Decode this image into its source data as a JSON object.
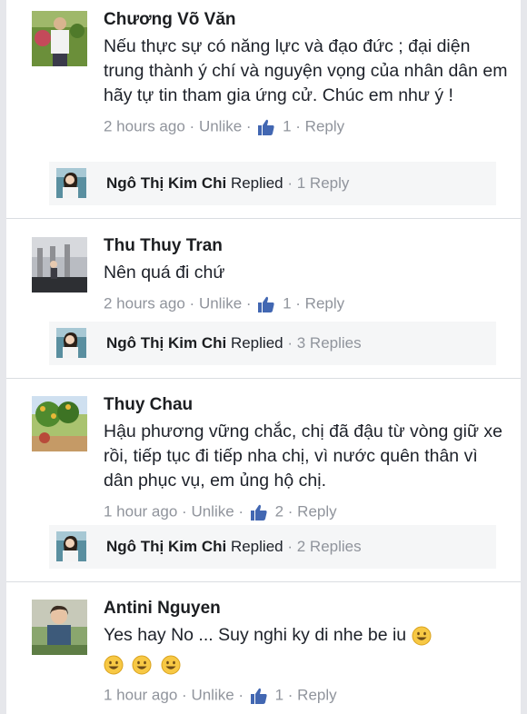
{
  "comments": [
    {
      "author": "Chương Võ Văn",
      "text": "Nếu thực sự có năng lực và đạo đức ; đại diện trung thành ý chí và nguyện vọng của nhân dân em hãy tự tin tham gia ứng cử. Chúc em như ý !",
      "time": "2 hours ago",
      "unlike": "Unlike",
      "likes": "1",
      "reply": "Reply",
      "replied": {
        "name": "Ngô Thị Kim Chi",
        "verb": "Replied",
        "count": "1 Reply"
      }
    },
    {
      "author": "Thu Thuy Tran",
      "text": "Nên quá đi chứ",
      "time": "2 hours ago",
      "unlike": "Unlike",
      "likes": "1",
      "reply": "Reply",
      "replied": {
        "name": "Ngô Thị Kim Chi",
        "verb": "Replied",
        "count": "3 Replies"
      }
    },
    {
      "author": "Thuy Chau",
      "text": "Hậu phương vững chắc, chị đã đậu từ vòng giữ xe rồi, tiếp tục đi tiếp nha chị, vì nước quên thân vì dân phục vụ, em ủng hộ chị.",
      "time": "1 hour ago",
      "unlike": "Unlike",
      "likes": "2",
      "reply": "Reply",
      "replied": {
        "name": "Ngô Thị Kim Chi",
        "verb": "Replied",
        "count": "2 Replies"
      }
    },
    {
      "author": "Antini Nguyen",
      "text": "Yes hay No ... Suy nghi ky di nhe be iu",
      "time": "1 hour ago",
      "unlike": "Unlike",
      "likes": "1",
      "reply": "Reply"
    }
  ],
  "meta_separator": "·",
  "icons": {
    "like": "thumbs-up-icon",
    "emoji": "smiley-emoji-icon"
  },
  "colors": {
    "like_blue": "#4267b2",
    "meta_gray": "#90949c",
    "reply_bg": "#f5f6f7",
    "emoji_yellow": "#f7c844"
  }
}
